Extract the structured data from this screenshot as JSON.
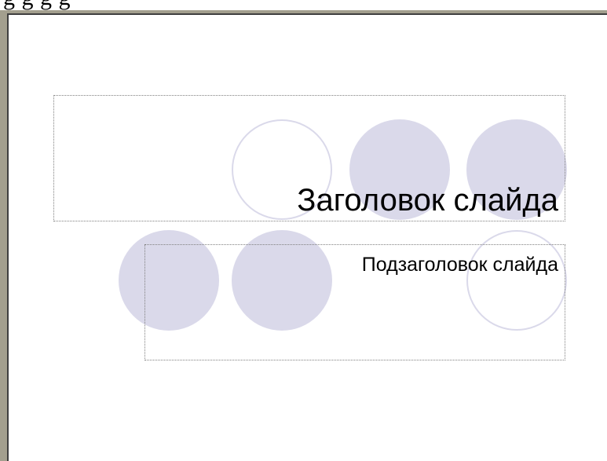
{
  "top_strip": {
    "text": "g g g g"
  },
  "slide": {
    "title_placeholder": {
      "text": "Заголовок слайда"
    },
    "subtitle_placeholder": {
      "text": "Подзаголовок слайда"
    },
    "decor": {
      "filled_color": "#dad9ea",
      "outline_color": "#dad9ea"
    }
  }
}
